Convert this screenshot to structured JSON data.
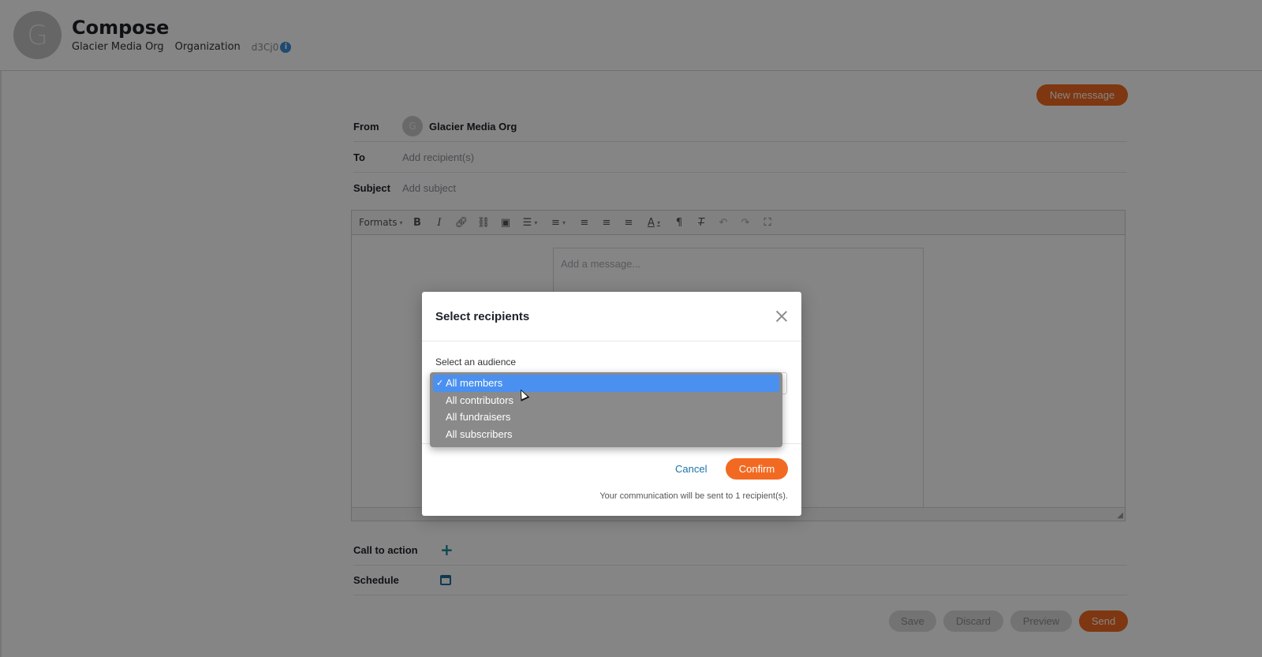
{
  "header": {
    "avatar_letter": "G",
    "title": "Compose",
    "org_name": "Glacier Media Org",
    "org_type": "Organization",
    "org_id": "d3Cj0",
    "info_icon": "i"
  },
  "compose": {
    "new_message_label": "New message",
    "from_label": "From",
    "from_avatar_letter": "G",
    "from_value": "Glacier Media Org",
    "to_label": "To",
    "to_placeholder": "Add recipient(s)",
    "subject_label": "Subject",
    "subject_placeholder": "Add subject",
    "message_placeholder": "Add a message...",
    "call_to_action_label": "Call to action",
    "schedule_label": "Schedule"
  },
  "toolbar": {
    "formats_label": "Formats",
    "icons": [
      "bold-icon",
      "italic-icon",
      "link-icon",
      "unlink-icon",
      "image-icon",
      "bullet-list-icon",
      "numbered-list-icon",
      "align-left-icon",
      "align-center-icon",
      "align-right-icon",
      "text-color-icon",
      "paragraph-icon",
      "clear-format-icon",
      "undo-icon",
      "redo-icon",
      "fullscreen-icon"
    ]
  },
  "footer_actions": {
    "save": "Save",
    "discard": "Discard",
    "preview": "Preview",
    "send": "Send"
  },
  "modal": {
    "title": "Select recipients",
    "audience_label": "Select an audience",
    "cancel": "Cancel",
    "confirm": "Confirm",
    "note": "Your communication will be sent to 1 recipient(s)."
  },
  "dropdown": {
    "options": [
      "All members",
      "All contributors",
      "All fundraisers",
      "All subscribers"
    ],
    "selected": "All members",
    "check": "✓"
  },
  "colors": {
    "accent": "#f26a22",
    "selection": "#4a90f0",
    "link": "#1a73a8"
  }
}
